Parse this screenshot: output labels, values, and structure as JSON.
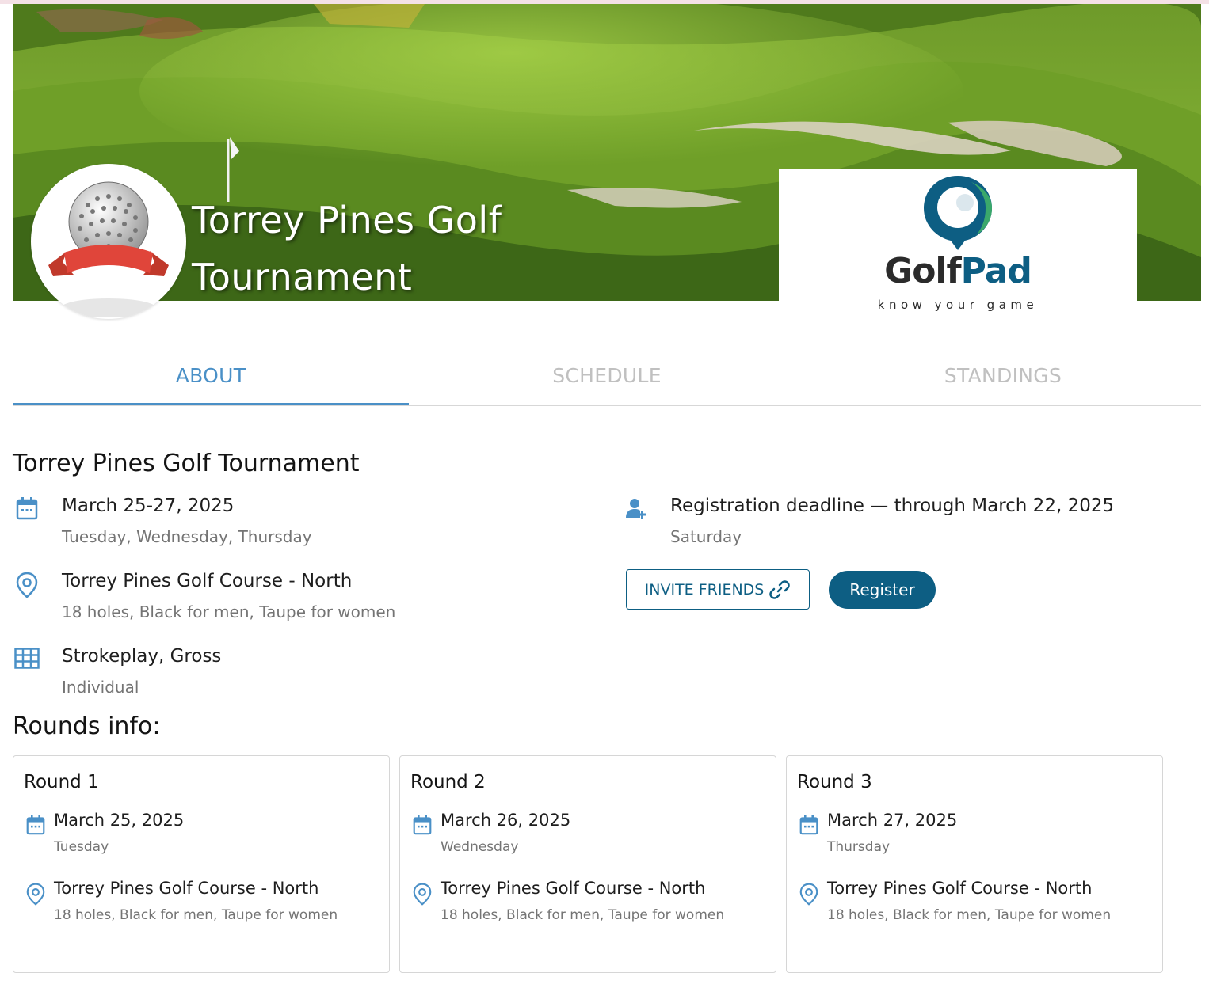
{
  "header": {
    "title_line1": "Torrey Pines Golf",
    "title_line2": "Tournament",
    "sponsor": {
      "name_part1": "Golf",
      "name_part2": "Pad",
      "tagline": "know your game"
    }
  },
  "tabs": [
    {
      "label": "ABOUT",
      "active": true
    },
    {
      "label": "SCHEDULE",
      "active": false
    },
    {
      "label": "STANDINGS",
      "active": false
    }
  ],
  "about": {
    "title": "Torrey Pines Golf Tournament",
    "dates": {
      "main": "March 25-27, 2025",
      "sub": "Tuesday, Wednesday, Thursday",
      "icon": "calendar-icon"
    },
    "course": {
      "main": "Torrey Pines Golf Course - North",
      "sub": "18 holes, Black for men, Taupe for women",
      "icon": "location-pin-icon"
    },
    "format": {
      "main": "Strokeplay, Gross",
      "sub": "Individual",
      "icon": "table-grid-icon"
    },
    "registration": {
      "main": "Registration deadline — through March 22, 2025",
      "sub": "Saturday",
      "icon": "add-user-icon"
    },
    "invite_label": "INVITE FRIENDS",
    "register_label": "Register"
  },
  "rounds": {
    "title": "Rounds info:",
    "items": [
      {
        "name": "Round 1",
        "date": "March 25, 2025",
        "weekday": "Tuesday",
        "course": "Torrey Pines Golf Course - North",
        "details": "18 holes, Black for men, Taupe for women"
      },
      {
        "name": "Round 2",
        "date": "March 26, 2025",
        "weekday": "Wednesday",
        "course": "Torrey Pines Golf Course - North",
        "details": "18 holes, Black for men, Taupe for women"
      },
      {
        "name": "Round 3",
        "date": "March 27, 2025",
        "weekday": "Thursday",
        "course": "Torrey Pines Golf Course - North",
        "details": "18 holes, Black for men, Taupe for women"
      }
    ]
  },
  "colors": {
    "accent": "#4a90c7",
    "brand": "#0d5e83",
    "muted": "#747474",
    "tab_inactive": "#c0c0c0"
  }
}
